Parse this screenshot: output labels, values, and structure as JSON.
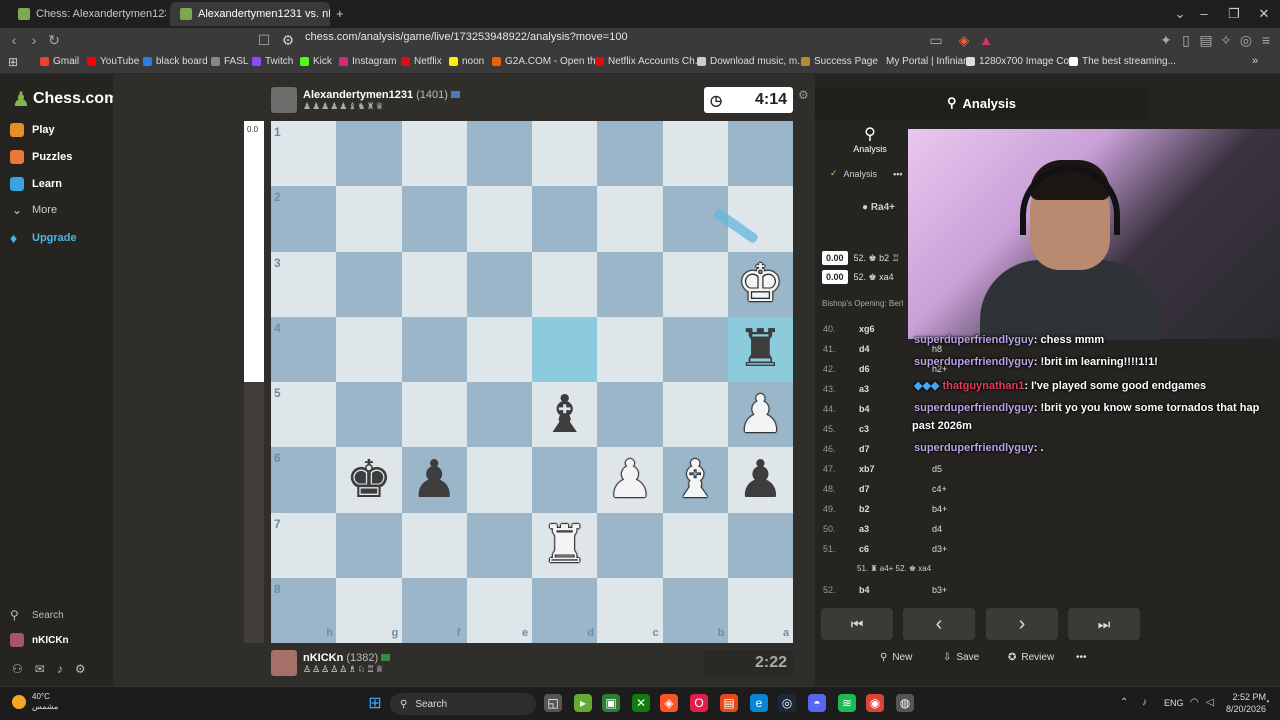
{
  "browser": {
    "tabs": [
      {
        "label": "Chess: Alexandertymen1231 vs nKICK"
      },
      {
        "label": "Alexandertymen1231 vs. nKICK"
      }
    ],
    "new_tab": "+",
    "url": "chess.com/analysis/game/live/173253948922/analysis?move=100",
    "bookmarks": [
      "Gmail",
      "YouTube",
      "black board",
      "FASL",
      "Twitch",
      "Kick",
      "Instagram",
      "Netflix",
      "noon",
      "G2A.COM - Open th...",
      "Netflix Accounts Ch...",
      "Download music, m...",
      "Success Page",
      "My Portal | Infiniarc",
      "1280x700 Image Co...",
      "The best streaming..."
    ]
  },
  "sidebar": {
    "logo": "Chess.com",
    "items": [
      {
        "label": "Play",
        "icon": "pawn-icon",
        "color": "#e58f2a"
      },
      {
        "label": "Puzzles",
        "icon": "puzzle-icon",
        "color": "#e8783a"
      },
      {
        "label": "Learn",
        "icon": "learn-icon",
        "color": "#3aa3e0"
      },
      {
        "label": "More",
        "icon": "chevron-down-icon",
        "color": "#cccccc"
      },
      {
        "label": "Upgrade",
        "icon": "diamond-icon",
        "color": "#4ab6e6"
      }
    ],
    "search": "Search",
    "username": "nKICKn"
  },
  "board": {
    "eval": "0.0",
    "ranks": [
      "1",
      "2",
      "3",
      "4",
      "5",
      "6",
      "7",
      "8"
    ],
    "files": [
      "h",
      "g",
      "f",
      "e",
      "d",
      "c",
      "b",
      "a"
    ],
    "top_player": {
      "name": "Alexandertymen1231",
      "rating": "(1401)",
      "clock": "4:14"
    },
    "bottom_player": {
      "name": "nKICKn",
      "rating": "(1382)",
      "clock": "2:22"
    },
    "pieces": [
      {
        "sq": "a3",
        "glyph": "♚",
        "side": "white"
      },
      {
        "sq": "a4",
        "glyph": "♜",
        "side": "black"
      },
      {
        "sq": "a5",
        "glyph": "♟",
        "side": "white"
      },
      {
        "sq": "d5",
        "glyph": "♝",
        "side": "black"
      },
      {
        "sq": "g6",
        "glyph": "♚",
        "side": "black"
      },
      {
        "sq": "f6",
        "glyph": "♟",
        "side": "black"
      },
      {
        "sq": "c6",
        "glyph": "♟",
        "side": "white"
      },
      {
        "sq": "b6",
        "glyph": "♝",
        "side": "white"
      },
      {
        "sq": "a6",
        "glyph": "♟",
        "side": "black"
      },
      {
        "sq": "d7",
        "glyph": "♜",
        "side": "white"
      }
    ],
    "highlights": [
      "d4",
      "a4"
    ]
  },
  "panel": {
    "title": "Analysis",
    "tab_analysis": "Analysis",
    "analysis_toggle": "Analysis",
    "best_line": "Ra4+",
    "lines": [
      {
        "score": "0.00",
        "text": "52. ♚ b2 ♖"
      },
      {
        "score": "0.00",
        "text": "52. ♚ xa4"
      }
    ],
    "opening": "Bishop's Opening: Berl",
    "moves": [
      {
        "n": "40.",
        "w": "xg6",
        "b": ""
      },
      {
        "n": "41.",
        "w": "d4",
        "b": "h8"
      },
      {
        "n": "42.",
        "w": "d6",
        "b": "h2+"
      },
      {
        "n": "43.",
        "w": "a3",
        "b": ""
      },
      {
        "n": "44.",
        "w": "b4",
        "b": ""
      },
      {
        "n": "45.",
        "w": "c3",
        "b": ""
      },
      {
        "n": "46.",
        "w": "d7",
        "b": ""
      },
      {
        "n": "47.",
        "w": "xb7",
        "b": "d5"
      },
      {
        "n": "48.",
        "w": "d7",
        "b": "c4+"
      },
      {
        "n": "49.",
        "w": "b2",
        "b": "b4+"
      },
      {
        "n": "50.",
        "w": "a3",
        "b": "d4"
      },
      {
        "n": "51.",
        "w": "c6",
        "b": "d3+"
      },
      {
        "n": "52.",
        "w": "b4",
        "b": "b3+"
      }
    ],
    "variation": "51. ♜ a4+  52. ♚ xa4",
    "controls": [
      "⏮",
      "‹",
      "›",
      "⏭"
    ],
    "footer": {
      "new": "New",
      "save": "Save",
      "review": "Review",
      "more": "•••"
    }
  },
  "chat": [
    {
      "user": "superduperfriendlyguy",
      "msg": ": chess mmm"
    },
    {
      "user": "superduperfriendlyguy",
      "msg": ": !brit im learning!!!!1!1!"
    },
    {
      "user": "thatguynathan1",
      "msg": ": I've played some good endgames"
    },
    {
      "user": "superduperfriendlyguy",
      "msg": ": !brit yo you know some tornados that hap"
    },
    {
      "user": "",
      "msg": "past 2026m"
    },
    {
      "user": "superduperfriendlyguy",
      "msg": ": ."
    }
  ],
  "taskbar": {
    "weather_temp": "40°C",
    "weather_desc": "مشمس",
    "search": "Search",
    "lang": "ENG",
    "time": "2:52 PM",
    "date": "8/20/2026"
  }
}
